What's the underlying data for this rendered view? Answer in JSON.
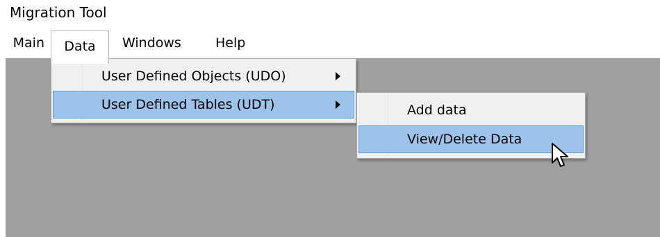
{
  "window": {
    "title": "Migration Tool"
  },
  "menubar": {
    "items": [
      {
        "id": "main",
        "label": "Main"
      },
      {
        "id": "data",
        "label": "Data"
      },
      {
        "id": "windows",
        "label": "Windows"
      },
      {
        "id": "help",
        "label": "Help"
      }
    ]
  },
  "data_menu": {
    "items": [
      {
        "label": "User Defined Objects (UDO)",
        "has_submenu": true,
        "highlighted": false
      },
      {
        "label": "User Defined Tables (UDT)",
        "has_submenu": true,
        "highlighted": true
      }
    ]
  },
  "udt_submenu": {
    "items": [
      {
        "label": "Add data",
        "highlighted": false
      },
      {
        "label": "View/Delete Data",
        "highlighted": true
      }
    ]
  },
  "colors": {
    "workspace": "#a0a0a0",
    "menu_background": "#f0f0f0",
    "highlight_fill": "#9dc3ea",
    "highlight_border": "#57a0e6"
  },
  "cursor": {
    "icon": "arrow-cursor-icon"
  }
}
